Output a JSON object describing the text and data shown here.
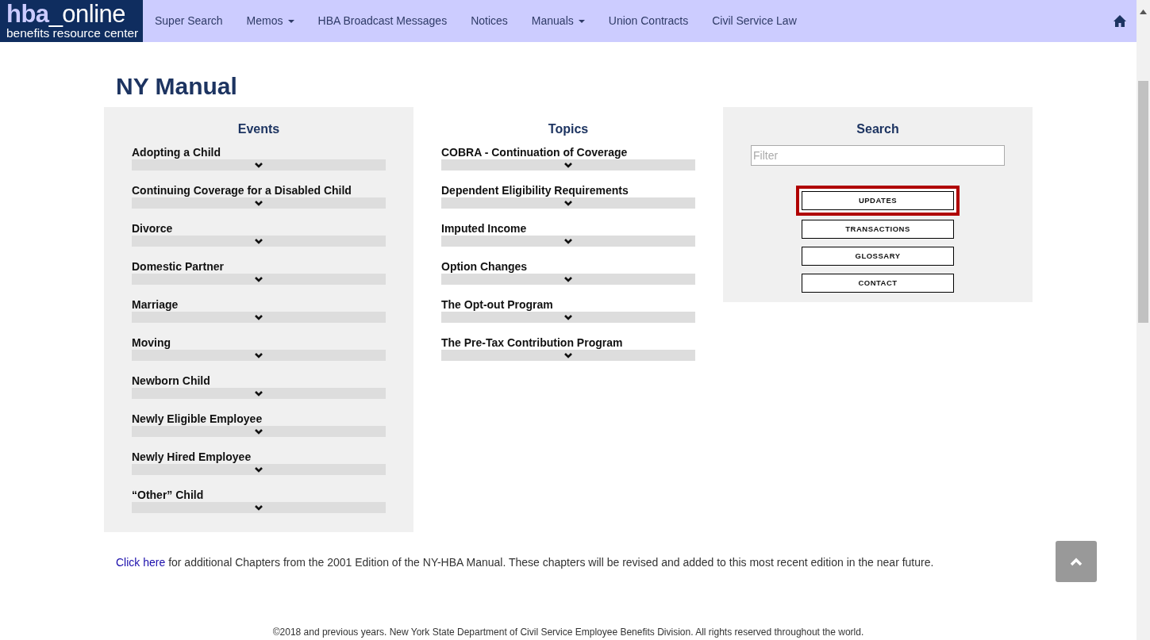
{
  "brand": {
    "title_bold": "hba",
    "title_rest": "_online",
    "subtitle": "benefits resource center"
  },
  "nav": [
    {
      "label": "Super Search",
      "kind": "link"
    },
    {
      "label": "Memos",
      "kind": "dropdown"
    },
    {
      "label": "HBA Broadcast Messages",
      "kind": "link"
    },
    {
      "label": "Notices",
      "kind": "link"
    },
    {
      "label": "Manuals",
      "kind": "dropdown"
    },
    {
      "label": "Union Contracts",
      "kind": "link"
    },
    {
      "label": "Civil Service Law",
      "kind": "link"
    }
  ],
  "page_title": "NY Manual",
  "events": {
    "heading": "Events",
    "items": [
      {
        "label": "Adopting a Child",
        "expanded": false
      },
      {
        "label": "Continuing Coverage for a Disabled Child",
        "expanded": false
      },
      {
        "label": "Divorce",
        "expanded": false
      },
      {
        "label": "Domestic Partner",
        "expanded": false
      },
      {
        "label": "Marriage",
        "expanded": false
      },
      {
        "label": "Moving",
        "expanded": false
      },
      {
        "label": "Newborn Child",
        "expanded": false
      },
      {
        "label": "Newly Eligible Employee",
        "expanded": false
      },
      {
        "label": "Newly Hired Employee",
        "expanded": false
      },
      {
        "label": "“Other” Child",
        "expanded": false
      }
    ]
  },
  "topics": {
    "heading": "Topics",
    "items": [
      {
        "label": "COBRA - Continuation of Coverage",
        "expanded": false
      },
      {
        "label": "Dependent Eligibility Requirements",
        "expanded": false
      },
      {
        "label": "Imputed Income",
        "expanded": false
      },
      {
        "label": "Option Changes",
        "expanded": false
      },
      {
        "label": "The Opt-out Program",
        "expanded": false
      },
      {
        "label": "The Pre-Tax Contribution Program",
        "expanded": false
      }
    ]
  },
  "search": {
    "heading": "Search",
    "placeholder": "Filter",
    "buttons": [
      {
        "label": "UPDATES",
        "selected": true
      },
      {
        "label": "TRANSACTIONS",
        "selected": false
      },
      {
        "label": "GLOSSARY",
        "selected": false
      },
      {
        "label": "CONTACT",
        "selected": false
      }
    ]
  },
  "note": {
    "link": "Click here",
    "text": " for additional Chapters from the 2001 Edition of the NY-HBA Manual. These chapters will be revised and added to this most recent edition in the near future."
  },
  "footer": "©2018 and previous years. New York State Department of Civil Service Employee Benefits Division. All rights reserved throughout the world."
}
